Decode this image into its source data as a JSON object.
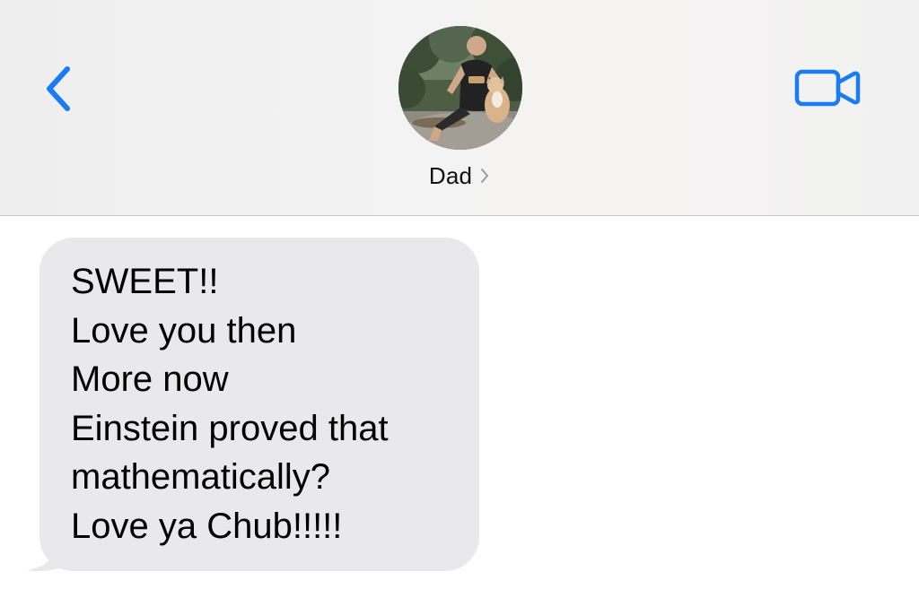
{
  "header": {
    "back_icon": "chevron-left-icon",
    "video_icon": "video-camera-icon",
    "contact": {
      "name": "Dad",
      "chevron_icon": "chevron-right-icon",
      "avatar_icon": "contact-photo"
    },
    "accent_color": "#1a7cf5"
  },
  "messages": [
    {
      "direction": "incoming",
      "lines": [
        "SWEET!!",
        "Love you then",
        "More now",
        "Einstein proved that",
        "mathematically?",
        "Love ya Chub!!!!!"
      ],
      "bubble_color": "#e9e9eb"
    }
  ]
}
